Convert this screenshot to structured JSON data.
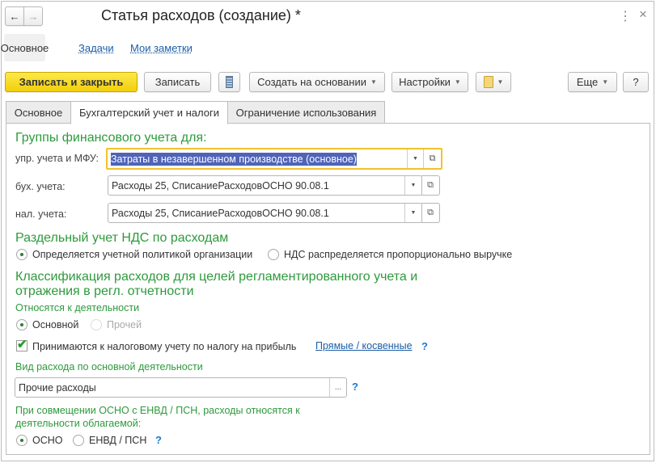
{
  "window": {
    "title": "Статья расходов (создание) *",
    "back_icon": "←",
    "forward_icon": "→",
    "menu_icon": "⋮",
    "close_icon": "×"
  },
  "nav": {
    "items": [
      "Основное",
      "Задачи",
      "Мои заметки"
    ]
  },
  "toolbar": {
    "save_close": "Записать и закрыть",
    "save": "Записать",
    "create_based": "Создать на основании",
    "settings": "Настройки",
    "more": "Еще",
    "help": "?"
  },
  "tabs": [
    "Основное",
    "Бухгалтерский учет и налоги",
    "Ограничение использования"
  ],
  "fin_groups": {
    "heading": "Группы финансового учета для:",
    "rows": [
      {
        "label": "упр. учета и МФУ:",
        "value": "Затраты в незавершенном производстве (основное)"
      },
      {
        "label": "бух. учета:",
        "value": "Расходы 25, СписаниеРасходовОСНО 90.08.1"
      },
      {
        "label": "нал. учета:",
        "value": "Расходы 25, СписаниеРасходовОСНО 90.08.1"
      }
    ]
  },
  "vat": {
    "heading": "Раздельный учет НДС по расходам",
    "options": [
      "Определяется учетной политикой организации",
      "НДС распределяется пропорционально выручке"
    ],
    "selected": 0
  },
  "classification": {
    "heading_line1": "Классификация расходов для целей регламентированного учета и",
    "heading_line2": "отражения в регл. отчетности",
    "activity_label": "Относятся к деятельности",
    "activity_options": [
      "Основной",
      "Прочей"
    ],
    "activity_selected": 0,
    "tax_checkbox": "Принимаются к налоговому учету по налогу на прибыль",
    "tax_checked": true,
    "direct_link": "Прямые / косвенные",
    "help": "?",
    "expense_type_label": "Вид расхода по основной деятельности",
    "expense_type_value": "Прочие расходы",
    "ellipsis": "...",
    "combo_label_line1": "При совмещении ОСНО с ЕНВД / ПСН, расходы относятся к",
    "combo_label_line2": "деятельности облагаемой:",
    "combo_options": [
      "ОСНО",
      "ЕНВД / ПСН"
    ],
    "combo_selected": 0
  }
}
